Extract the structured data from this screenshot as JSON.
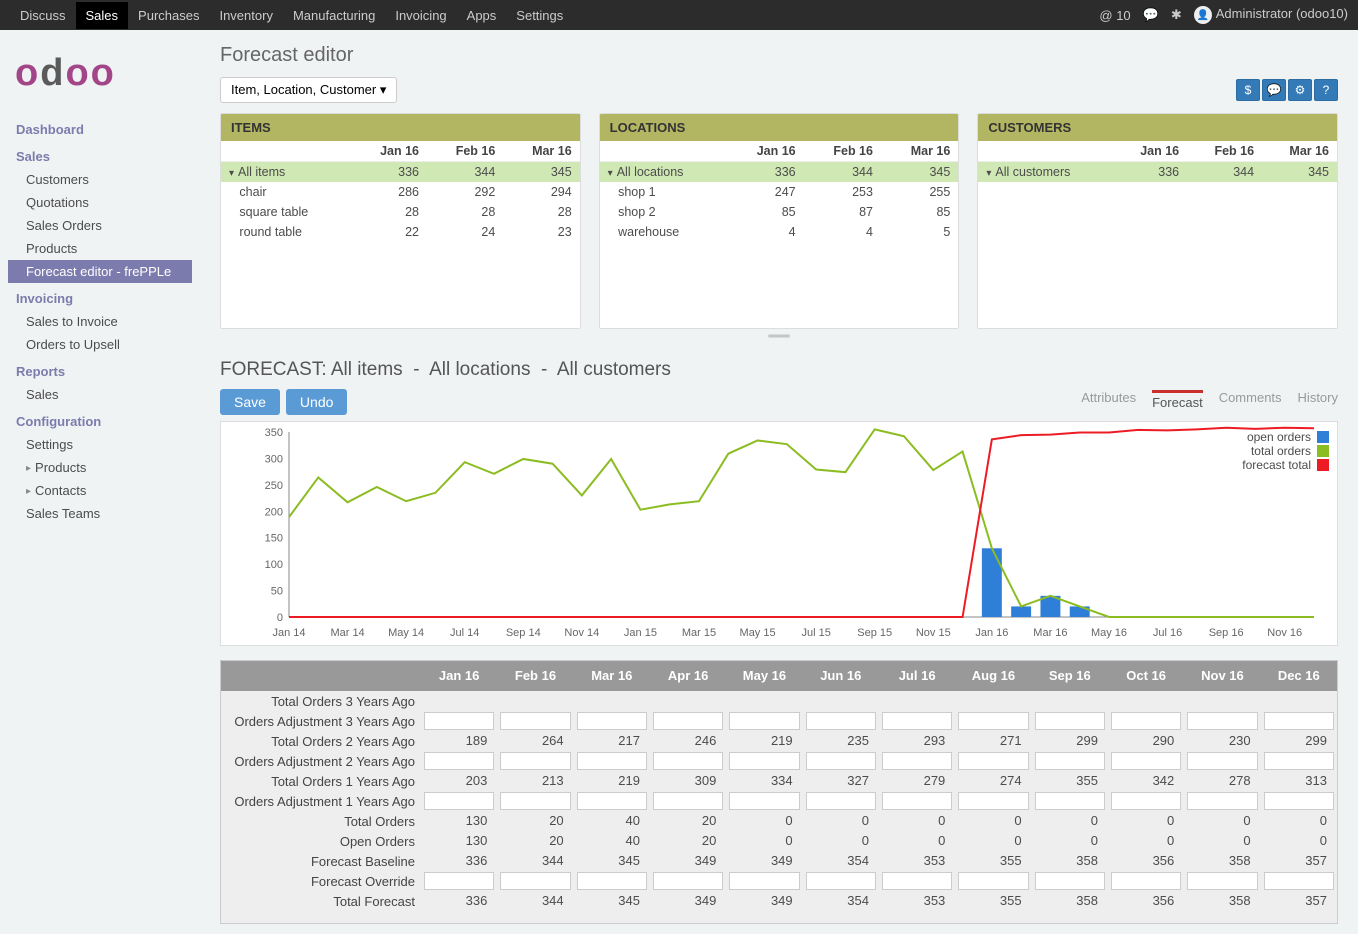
{
  "topnav": {
    "items": [
      "Discuss",
      "Sales",
      "Purchases",
      "Inventory",
      "Manufacturing",
      "Invoicing",
      "Apps",
      "Settings"
    ],
    "active": 1,
    "notif_count": "@ 10",
    "user": "Administrator (odoo10)"
  },
  "sidebar": {
    "dashboard": "Dashboard",
    "sales": "Sales",
    "sales_items": [
      "Customers",
      "Quotations",
      "Sales Orders",
      "Products",
      "Forecast editor - frePPLe"
    ],
    "sales_active": 4,
    "invoicing": "Invoicing",
    "invoicing_items": [
      "Sales to Invoice",
      "Orders to Upsell"
    ],
    "reports": "Reports",
    "reports_items": [
      "Sales"
    ],
    "configuration": "Configuration",
    "configuration_items": [
      "Settings",
      "Products",
      "Contacts",
      "Sales Teams"
    ],
    "configuration_arrow": [
      false,
      true,
      true,
      false
    ]
  },
  "page": {
    "title": "Forecast editor",
    "dropdown_label": "Item, Location, Customer",
    "forecast_title_parts": [
      "FORECAST: All items",
      "All locations",
      "All customers"
    ],
    "save": "Save",
    "undo": "Undo",
    "tabs": [
      "Attributes",
      "Forecast",
      "Comments",
      "History"
    ],
    "active_tab": 1
  },
  "panels": {
    "headers": [
      "ITEMS",
      "LOCATIONS",
      "CUSTOMERS"
    ],
    "columns": [
      "Jan 16",
      "Feb 16",
      "Mar 16"
    ],
    "items": [
      {
        "name": "All items",
        "vals": [
          336,
          344,
          345
        ],
        "hl": true,
        "expand": true
      },
      {
        "name": "chair",
        "vals": [
          286,
          292,
          294
        ]
      },
      {
        "name": "square table",
        "vals": [
          28,
          28,
          28
        ]
      },
      {
        "name": "round table",
        "vals": [
          22,
          24,
          23
        ]
      }
    ],
    "locations": [
      {
        "name": "All locations",
        "vals": [
          336,
          344,
          345
        ],
        "hl": true,
        "expand": true
      },
      {
        "name": "shop 1",
        "vals": [
          247,
          253,
          255
        ]
      },
      {
        "name": "shop 2",
        "vals": [
          85,
          87,
          85
        ]
      },
      {
        "name": "warehouse",
        "vals": [
          4,
          4,
          5
        ]
      }
    ],
    "customers": [
      {
        "name": "All customers",
        "vals": [
          336,
          344,
          345
        ],
        "hl": true,
        "expand": true
      }
    ]
  },
  "chart_data": {
    "type": "line+bar",
    "x_ticks": [
      "Jan 14",
      "Mar 14",
      "May 14",
      "Jul 14",
      "Sep 14",
      "Nov 14",
      "Jan 15",
      "Mar 15",
      "May 15",
      "Jul 15",
      "Sep 15",
      "Nov 15",
      "Jan 16",
      "Mar 16",
      "May 16",
      "Jul 16",
      "Sep 16",
      "Nov 16"
    ],
    "ylim": [
      0,
      350
    ],
    "y_ticks": [
      0,
      50,
      100,
      150,
      200,
      250,
      300,
      350
    ],
    "legend": [
      {
        "name": "open orders",
        "color": "#2f7ed8",
        "shape": "bar"
      },
      {
        "name": "total orders",
        "color": "#8bbc21",
        "shape": "line"
      },
      {
        "name": "forecast total",
        "color": "#ed1c24",
        "shape": "line"
      }
    ],
    "months": [
      "Jan 14",
      "Feb 14",
      "Mar 14",
      "Apr 14",
      "May 14",
      "Jun 14",
      "Jul 14",
      "Aug 14",
      "Sep 14",
      "Oct 14",
      "Nov 14",
      "Dec 14",
      "Jan 15",
      "Feb 15",
      "Mar 15",
      "Apr 15",
      "May 15",
      "Jun 15",
      "Jul 15",
      "Aug 15",
      "Sep 15",
      "Oct 15",
      "Nov 15",
      "Dec 15",
      "Jan 16",
      "Feb 16",
      "Mar 16",
      "Apr 16",
      "May 16",
      "Jun 16",
      "Jul 16",
      "Aug 16",
      "Sep 16",
      "Oct 16",
      "Nov 16",
      "Dec 16"
    ],
    "series": {
      "open_orders": [
        0,
        0,
        0,
        0,
        0,
        0,
        0,
        0,
        0,
        0,
        0,
        0,
        0,
        0,
        0,
        0,
        0,
        0,
        0,
        0,
        0,
        0,
        0,
        0,
        130,
        20,
        40,
        20,
        0,
        0,
        0,
        0,
        0,
        0,
        0,
        0
      ],
      "total_orders": [
        189,
        264,
        217,
        246,
        219,
        235,
        293,
        271,
        299,
        290,
        230,
        299,
        203,
        213,
        219,
        309,
        334,
        327,
        279,
        274,
        355,
        342,
        278,
        313,
        130,
        20,
        40,
        20,
        0,
        0,
        0,
        0,
        0,
        0,
        0,
        0
      ],
      "forecast_total": [
        0,
        0,
        0,
        0,
        0,
        0,
        0,
        0,
        0,
        0,
        0,
        0,
        0,
        0,
        0,
        0,
        0,
        0,
        0,
        0,
        0,
        0,
        0,
        0,
        336,
        344,
        345,
        349,
        349,
        354,
        353,
        355,
        358,
        356,
        358,
        357
      ]
    }
  },
  "grid": {
    "months": [
      "Jan 16",
      "Feb 16",
      "Mar 16",
      "Apr 16",
      "May 16",
      "Jun 16",
      "Jul 16",
      "Aug 16",
      "Sep 16",
      "Oct 16",
      "Nov 16",
      "Dec 16"
    ],
    "rows": [
      {
        "label": "Total Orders 3 Years Ago",
        "type": "text",
        "values": [
          "",
          "",
          "",
          "",
          "",
          "",
          "",
          "",
          "",
          "",
          "",
          ""
        ]
      },
      {
        "label": "Orders Adjustment 3 Years Ago",
        "type": "input",
        "values": [
          "",
          "",
          "",
          "",
          "",
          "",
          "",
          "",
          "",
          "",
          "",
          ""
        ]
      },
      {
        "label": "Total Orders 2 Years Ago",
        "type": "text",
        "values": [
          189,
          264,
          217,
          246,
          219,
          235,
          293,
          271,
          299,
          290,
          230,
          299
        ]
      },
      {
        "label": "Orders Adjustment 2 Years Ago",
        "type": "input",
        "values": [
          "",
          "",
          "",
          "",
          "",
          "",
          "",
          "",
          "",
          "",
          "",
          ""
        ]
      },
      {
        "label": "Total Orders 1 Years Ago",
        "type": "text",
        "values": [
          203,
          213,
          219,
          309,
          334,
          327,
          279,
          274,
          355,
          342,
          278,
          313
        ]
      },
      {
        "label": "Orders Adjustment 1 Years Ago",
        "type": "input",
        "values": [
          "",
          "",
          "",
          "",
          "",
          "",
          "",
          "",
          "",
          "",
          "",
          ""
        ]
      },
      {
        "label": "Total Orders",
        "type": "text",
        "values": [
          130,
          20,
          40,
          20,
          0,
          0,
          0,
          0,
          0,
          0,
          0,
          0
        ]
      },
      {
        "label": "Open Orders",
        "type": "text",
        "values": [
          130,
          20,
          40,
          20,
          0,
          0,
          0,
          0,
          0,
          0,
          0,
          0
        ]
      },
      {
        "label": "Forecast Baseline",
        "type": "text",
        "values": [
          336,
          344,
          345,
          349,
          349,
          354,
          353,
          355,
          358,
          356,
          358,
          357
        ]
      },
      {
        "label": "Forecast Override",
        "type": "input",
        "values": [
          "",
          "",
          "",
          "",
          "",
          "",
          "",
          "",
          "",
          "",
          "",
          ""
        ]
      },
      {
        "label": "Total Forecast",
        "type": "text",
        "values": [
          336,
          344,
          345,
          349,
          349,
          354,
          353,
          355,
          358,
          356,
          358,
          357
        ]
      }
    ]
  }
}
